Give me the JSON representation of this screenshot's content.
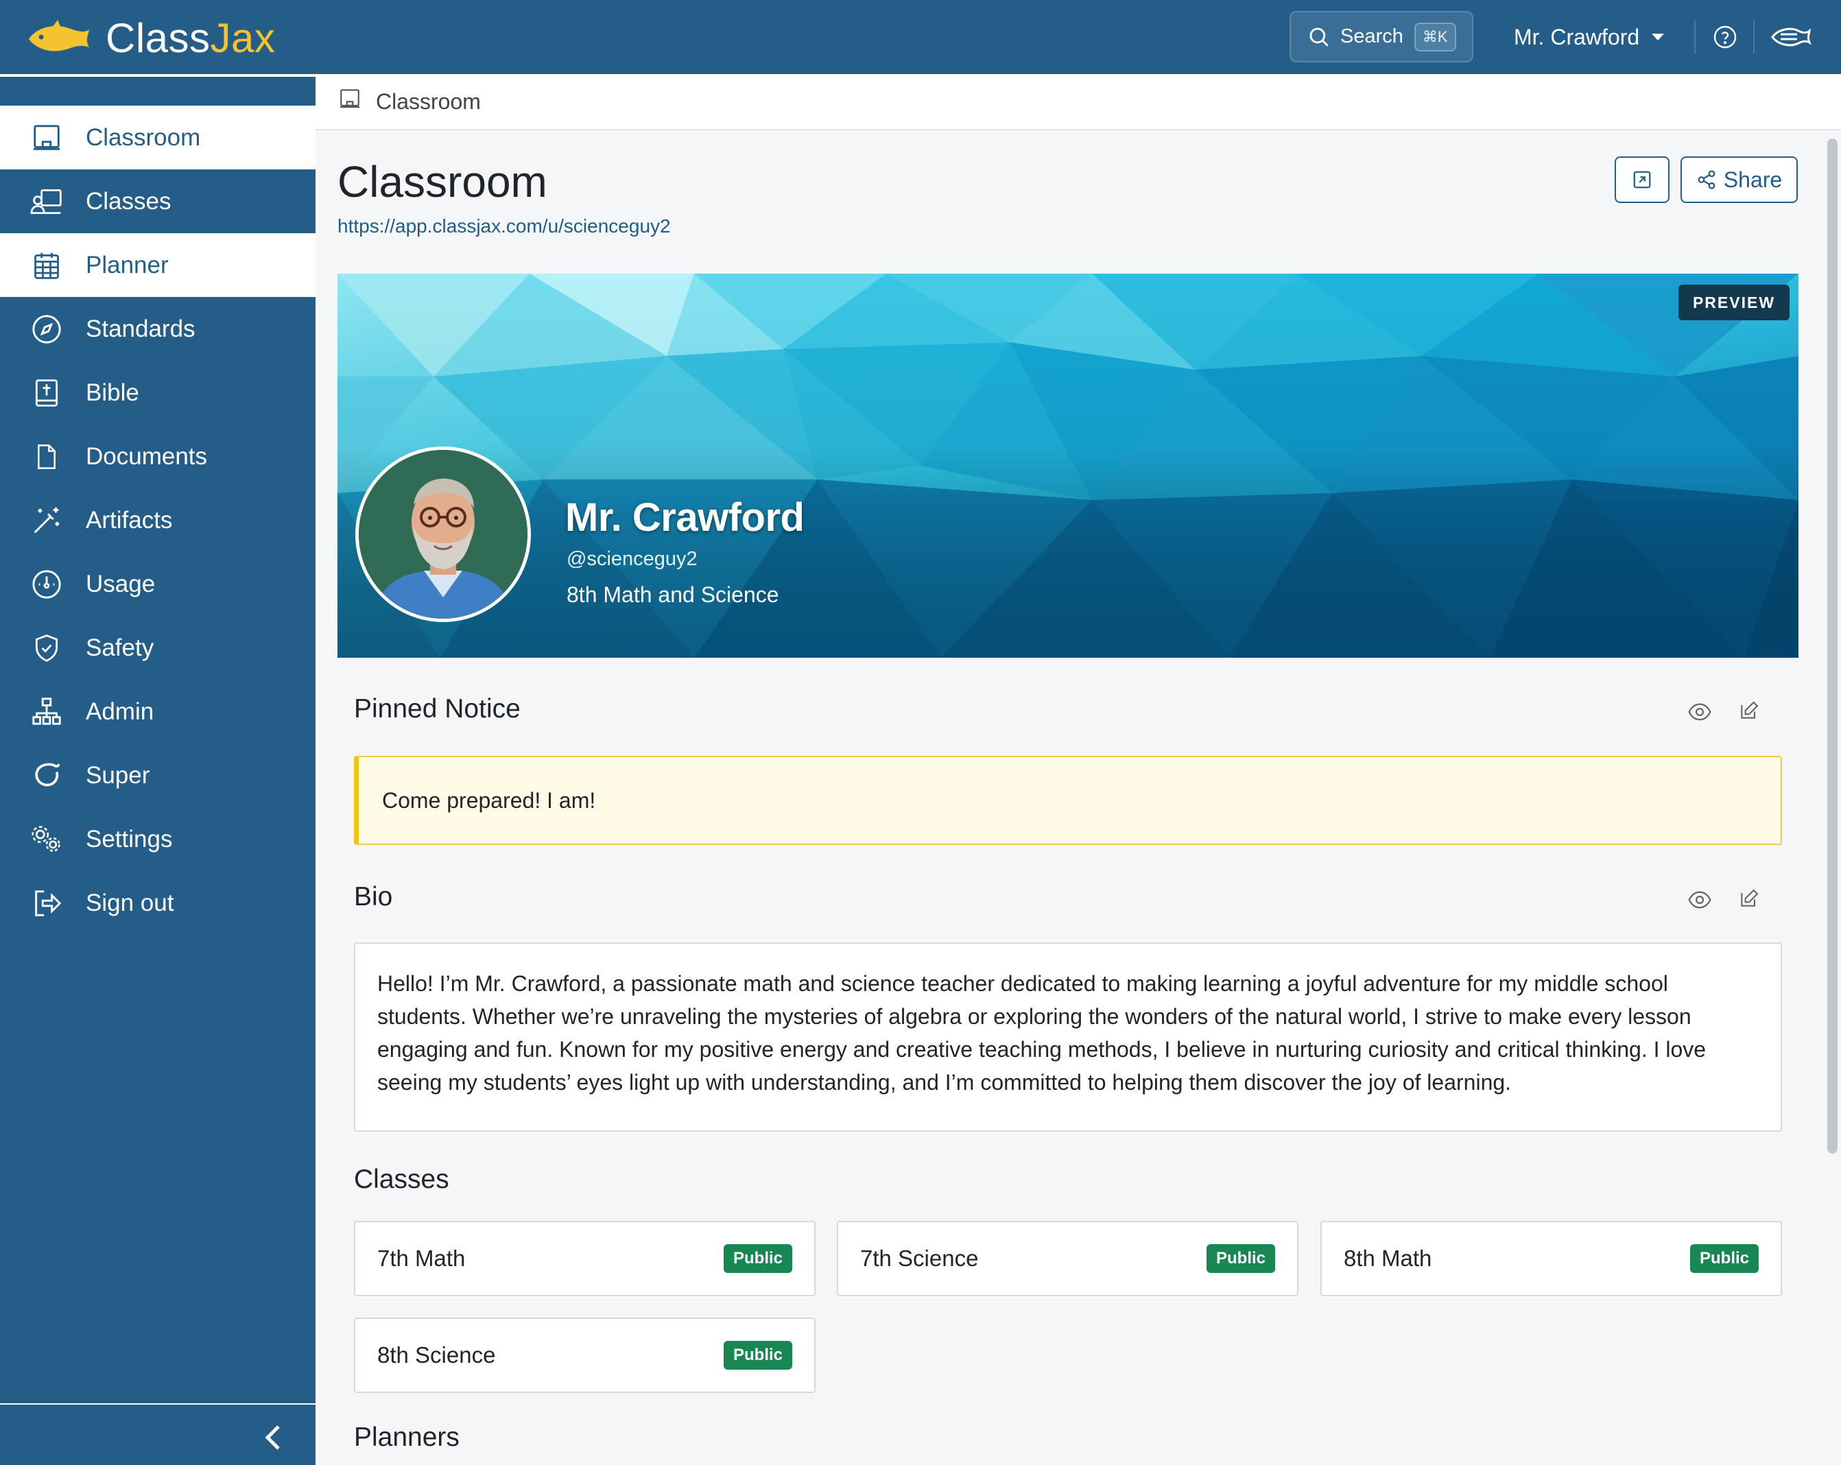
{
  "app": {
    "logo_text_primary": "Class",
    "logo_text_accent": "Jax",
    "search_label": "Search",
    "search_shortcut": "⌘K",
    "user_name": "Mr. Crawford",
    "colors": {
      "brand": "#245d87",
      "accent": "#f4c430",
      "success": "#198754"
    }
  },
  "sidebar": {
    "items": [
      {
        "label": "Classroom",
        "icon": "classroom-icon",
        "active": true
      },
      {
        "label": "Classes",
        "icon": "classes-icon",
        "active": false
      },
      {
        "label": "Planner",
        "icon": "calendar-icon",
        "active": true
      },
      {
        "label": "Standards",
        "icon": "compass-icon",
        "active": false
      },
      {
        "label": "Bible",
        "icon": "bible-icon",
        "active": false
      },
      {
        "label": "Documents",
        "icon": "document-icon",
        "active": false
      },
      {
        "label": "Artifacts",
        "icon": "magic-wand-icon",
        "active": false
      },
      {
        "label": "Usage",
        "icon": "gauge-icon",
        "active": false
      },
      {
        "label": "Safety",
        "icon": "shield-icon",
        "active": false
      },
      {
        "label": "Admin",
        "icon": "hierarchy-icon",
        "active": false
      },
      {
        "label": "Super",
        "icon": "super-icon",
        "active": false
      },
      {
        "label": "Settings",
        "icon": "gears-icon",
        "active": false
      },
      {
        "label": "Sign out",
        "icon": "sign-out-icon",
        "active": false
      }
    ]
  },
  "breadcrumb": {
    "label": "Classroom"
  },
  "page": {
    "title": "Classroom",
    "url": "https://app.classjax.com/u/scienceguy2",
    "share_label": "Share"
  },
  "profile": {
    "preview_badge": "PREVIEW",
    "name": "Mr. Crawford",
    "handle": "@scienceguy2",
    "subtitle": "8th Math and Science"
  },
  "pinned_notice": {
    "title": "Pinned Notice",
    "text": "Come prepared! I am!"
  },
  "bio": {
    "title": "Bio",
    "text": "Hello! I’m Mr. Crawford, a passionate math and science teacher dedicated to making learning a joyful adventure for my middle school students. Whether we’re unraveling the mysteries of algebra or exploring the wonders of the natural world, I strive to make every lesson engaging and fun. Known for my positive energy and creative teaching methods, I believe in nurturing curiosity and critical thinking. I love seeing my students’ eyes light up with understanding, and I’m committed to helping them discover the joy of learning."
  },
  "classes": {
    "title": "Classes",
    "items": [
      {
        "name": "7th Math",
        "badge": "Public"
      },
      {
        "name": "7th Science",
        "badge": "Public"
      },
      {
        "name": "8th Math",
        "badge": "Public"
      },
      {
        "name": "8th Science",
        "badge": "Public"
      }
    ]
  },
  "planners": {
    "title": "Planners"
  }
}
